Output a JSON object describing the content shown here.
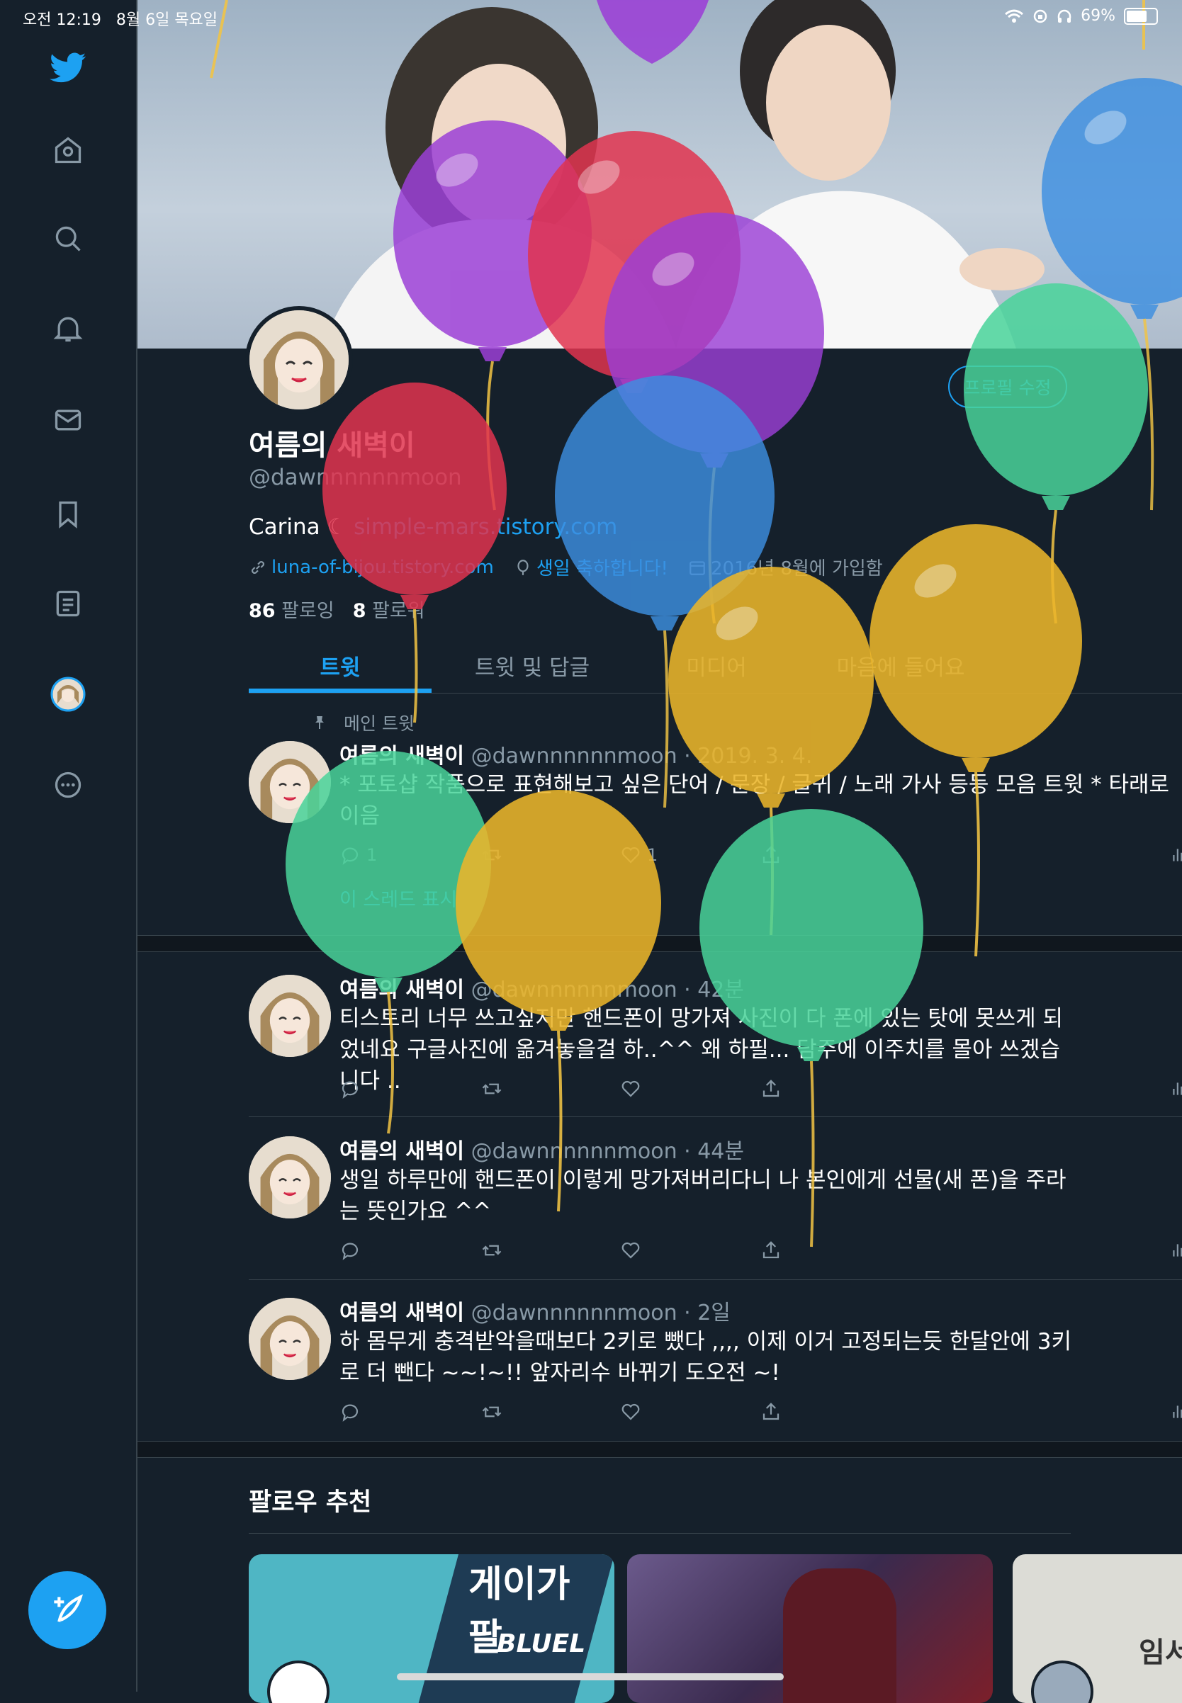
{
  "status_bar": {
    "time": "오전 12:19",
    "date": "8월 6일 목요일",
    "battery": "69%",
    "battery_level": 0.69
  },
  "sidebar": {
    "items": [
      "twitter-logo",
      "home",
      "explore",
      "notifications",
      "messages",
      "bookmarks",
      "lists",
      "profile",
      "more"
    ],
    "compose_icon": "compose-feather-plus-icon"
  },
  "profile": {
    "name": "여름의 새벽이",
    "handle": "@dawnnnnnnmoon",
    "edit_button": "프로필 수정",
    "bio_text": "Carina ☾",
    "bio_link": "simple-mars.tistory.com",
    "website": "luna-of-bijou.tistory.com",
    "birthday": "생일 축하합니다!",
    "joined": "2016년 8월에 가입함",
    "following_count": "86",
    "following_label": "팔로잉",
    "followers_count": "8",
    "followers_label": "팔로워"
  },
  "tabs": [
    {
      "label": "트윗",
      "active": true
    },
    {
      "label": "트윗 및 답글",
      "active": false
    },
    {
      "label": "미디어",
      "active": false
    },
    {
      "label": "마음에 들어요",
      "active": false
    }
  ],
  "pinned": {
    "label": "메인 트윗",
    "name": "여름의 새벽이",
    "handle_time": "@dawnnnnnnmoon · 2019. 3. 4.",
    "text": "* 포토샵 작품으로 표현해보고 싶은 단어 / 문장 / 글귀 / 노래 가사 등등 모음 트윗 * 타래로 이음",
    "replies": "1",
    "likes": "1",
    "thread_link": "이 스레드 표시"
  },
  "tweets": [
    {
      "name": "여름의 새벽이",
      "handle_time": "@dawnnnnnnmoon · 42분",
      "text": "티스토리 너무 쓰고싶지만 핸드폰이 망가져 사진이 다 폰에 있는 탓에 못쓰게 되었네요 구글사진에 옮겨놓을걸 하..^^ 왜 하필... 담주에 이주치를 몰아 쓰겠습니다 .."
    },
    {
      "name": "여름의 새벽이",
      "handle_time": "@dawnnnnnnmoon · 44분",
      "text": "생일 하루만에 핸드폰이 이렇게 망가져버리다니 나 본인에게 선물(새 폰)을 주라는 뜻인가요 ^^"
    },
    {
      "name": "여름의 새벽이",
      "handle_time": "@dawnnnnnnmoon · 2일",
      "text": "하 몸무게 충격받악을때보다 2키로 뺐다 ,,,, 이제 이거 고정되는듯 한달안에 3키로 더 뺀다 ~~!~!! 앞자리수 바뀌기 도오전 ~!"
    }
  ],
  "suggestions": {
    "title": "팔로우 추천",
    "card1_text": "게이가 팔",
    "card1_brand": "BLUEL",
    "card3_text": "임서"
  },
  "overlay": {
    "type": "birthday-balloons",
    "colors": [
      "#9b3fd6",
      "#e0344f",
      "#3d8fe0",
      "#49d39a",
      "#eab52a"
    ]
  }
}
